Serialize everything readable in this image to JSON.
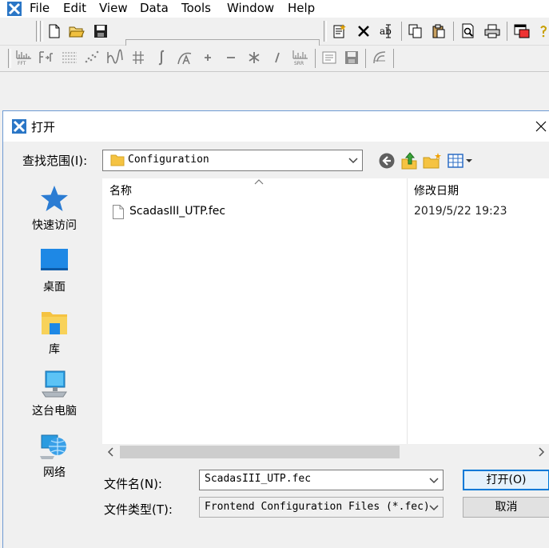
{
  "app": {
    "menu": [
      "File",
      "Edit",
      "View",
      "Data",
      "Tools",
      "Window",
      "Help"
    ],
    "toolbar2_text_icons": {
      "fft": "FFT",
      "srr": "SRR"
    }
  },
  "dialog": {
    "title": "打开",
    "look_in_label": "查找范围(I):",
    "look_in_value": "Configuration",
    "places": [
      {
        "label": "快速访问",
        "icon": "star-icon"
      },
      {
        "label": "桌面",
        "icon": "desktop-icon"
      },
      {
        "label": "库",
        "icon": "library-icon"
      },
      {
        "label": "这台电脑",
        "icon": "computer-icon"
      },
      {
        "label": "网络",
        "icon": "network-icon"
      }
    ],
    "columns": {
      "name": "名称",
      "date_modified": "修改日期"
    },
    "files": [
      {
        "name": "ScadasIII_UTP.fec",
        "date": "2019/5/22 19:23"
      }
    ],
    "file_name_label": "文件名(N):",
    "file_name_value": "ScadasIII_UTP.fec",
    "file_type_label": "文件类型(T):",
    "file_type_value": "Frontend Configuration Files (*.fec)",
    "open_label": "打开(O)",
    "cancel_label": "取消"
  },
  "colors": {
    "accent_border": "#0078d7",
    "button_focus_bg": "#e5f1fb",
    "folder_yellow": "#f5c342",
    "star_blue": "#2b7cd3"
  }
}
